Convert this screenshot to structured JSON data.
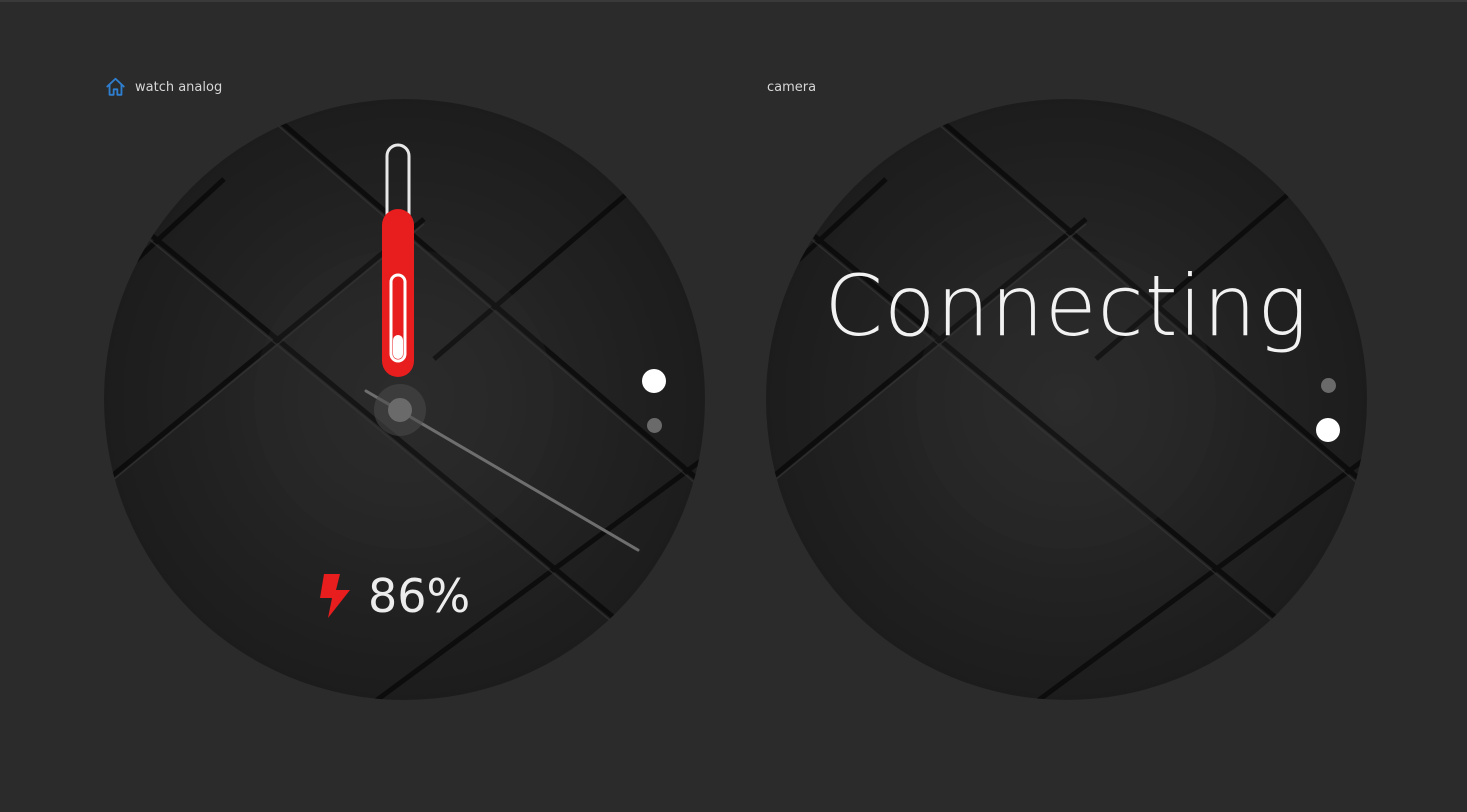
{
  "panels": {
    "left": {
      "title": "watch analog",
      "icon": "home-icon",
      "battery": {
        "icon": "lightning-bolt-icon",
        "text": "86%",
        "level_percent": 86
      },
      "page_indicator": {
        "count": 2,
        "active_index": 0
      }
    },
    "right": {
      "title": "camera",
      "status_text": "Connecting",
      "page_indicator": {
        "count": 2,
        "active_index": 1
      }
    }
  },
  "colors": {
    "background": "#2b2b2b",
    "accent_red": "#e81d1d",
    "home_icon_blue": "#2f7fd1",
    "text_light": "#ececec"
  }
}
